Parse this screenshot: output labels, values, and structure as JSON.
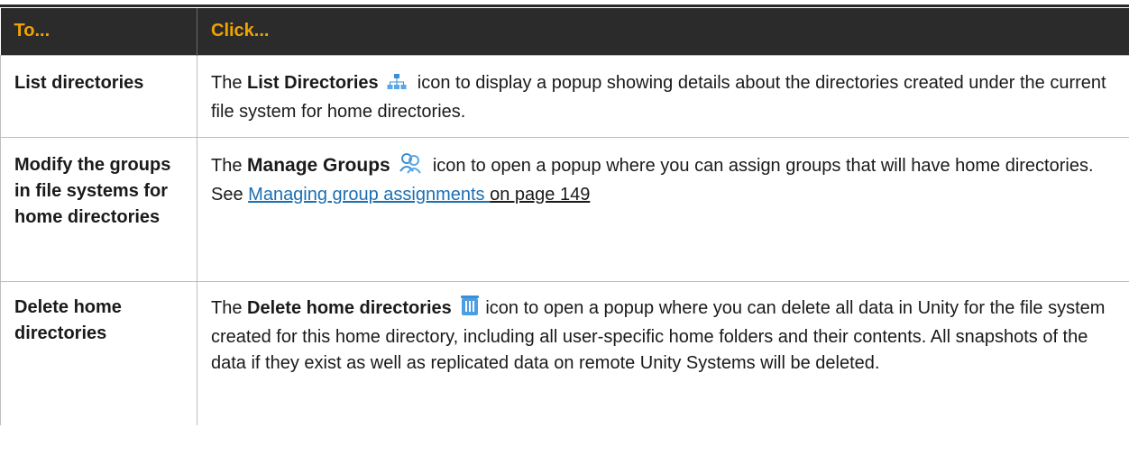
{
  "header": {
    "col1": "To...",
    "col2": "Click..."
  },
  "rows": [
    {
      "task": "List directories",
      "desc_pre": "The ",
      "desc_bold": "List Directories",
      "icon": "list-directories-icon",
      "desc_post": " icon to display a popup showing details about the directories created under the current file system for home directories."
    },
    {
      "task": "Modify the groups in file systems for home directories",
      "desc_pre": "The ",
      "desc_bold": "Manage Groups",
      "icon": "manage-groups-icon",
      "desc_post": " icon to open a popup where you can assign groups that will have home directories. See ",
      "link_text": "Managing group assignments ",
      "link_post": "on page 149"
    },
    {
      "task": "Delete home directories",
      "desc_pre": "The ",
      "desc_bold": "Delete home directories",
      "icon": "trash-icon",
      "desc_post": "icon to open a popup where you can delete all data in Unity for the file system created for this home directory, including all user-specific home folders and their contents. All snapshots of the data if they exist as well as replicated data on remote Unity Systems will be deleted."
    }
  ],
  "colors": {
    "header_bg": "#2b2b2b",
    "header_text": "#f0a400",
    "link": "#1b6fb3",
    "border": "#bdbdbd"
  }
}
